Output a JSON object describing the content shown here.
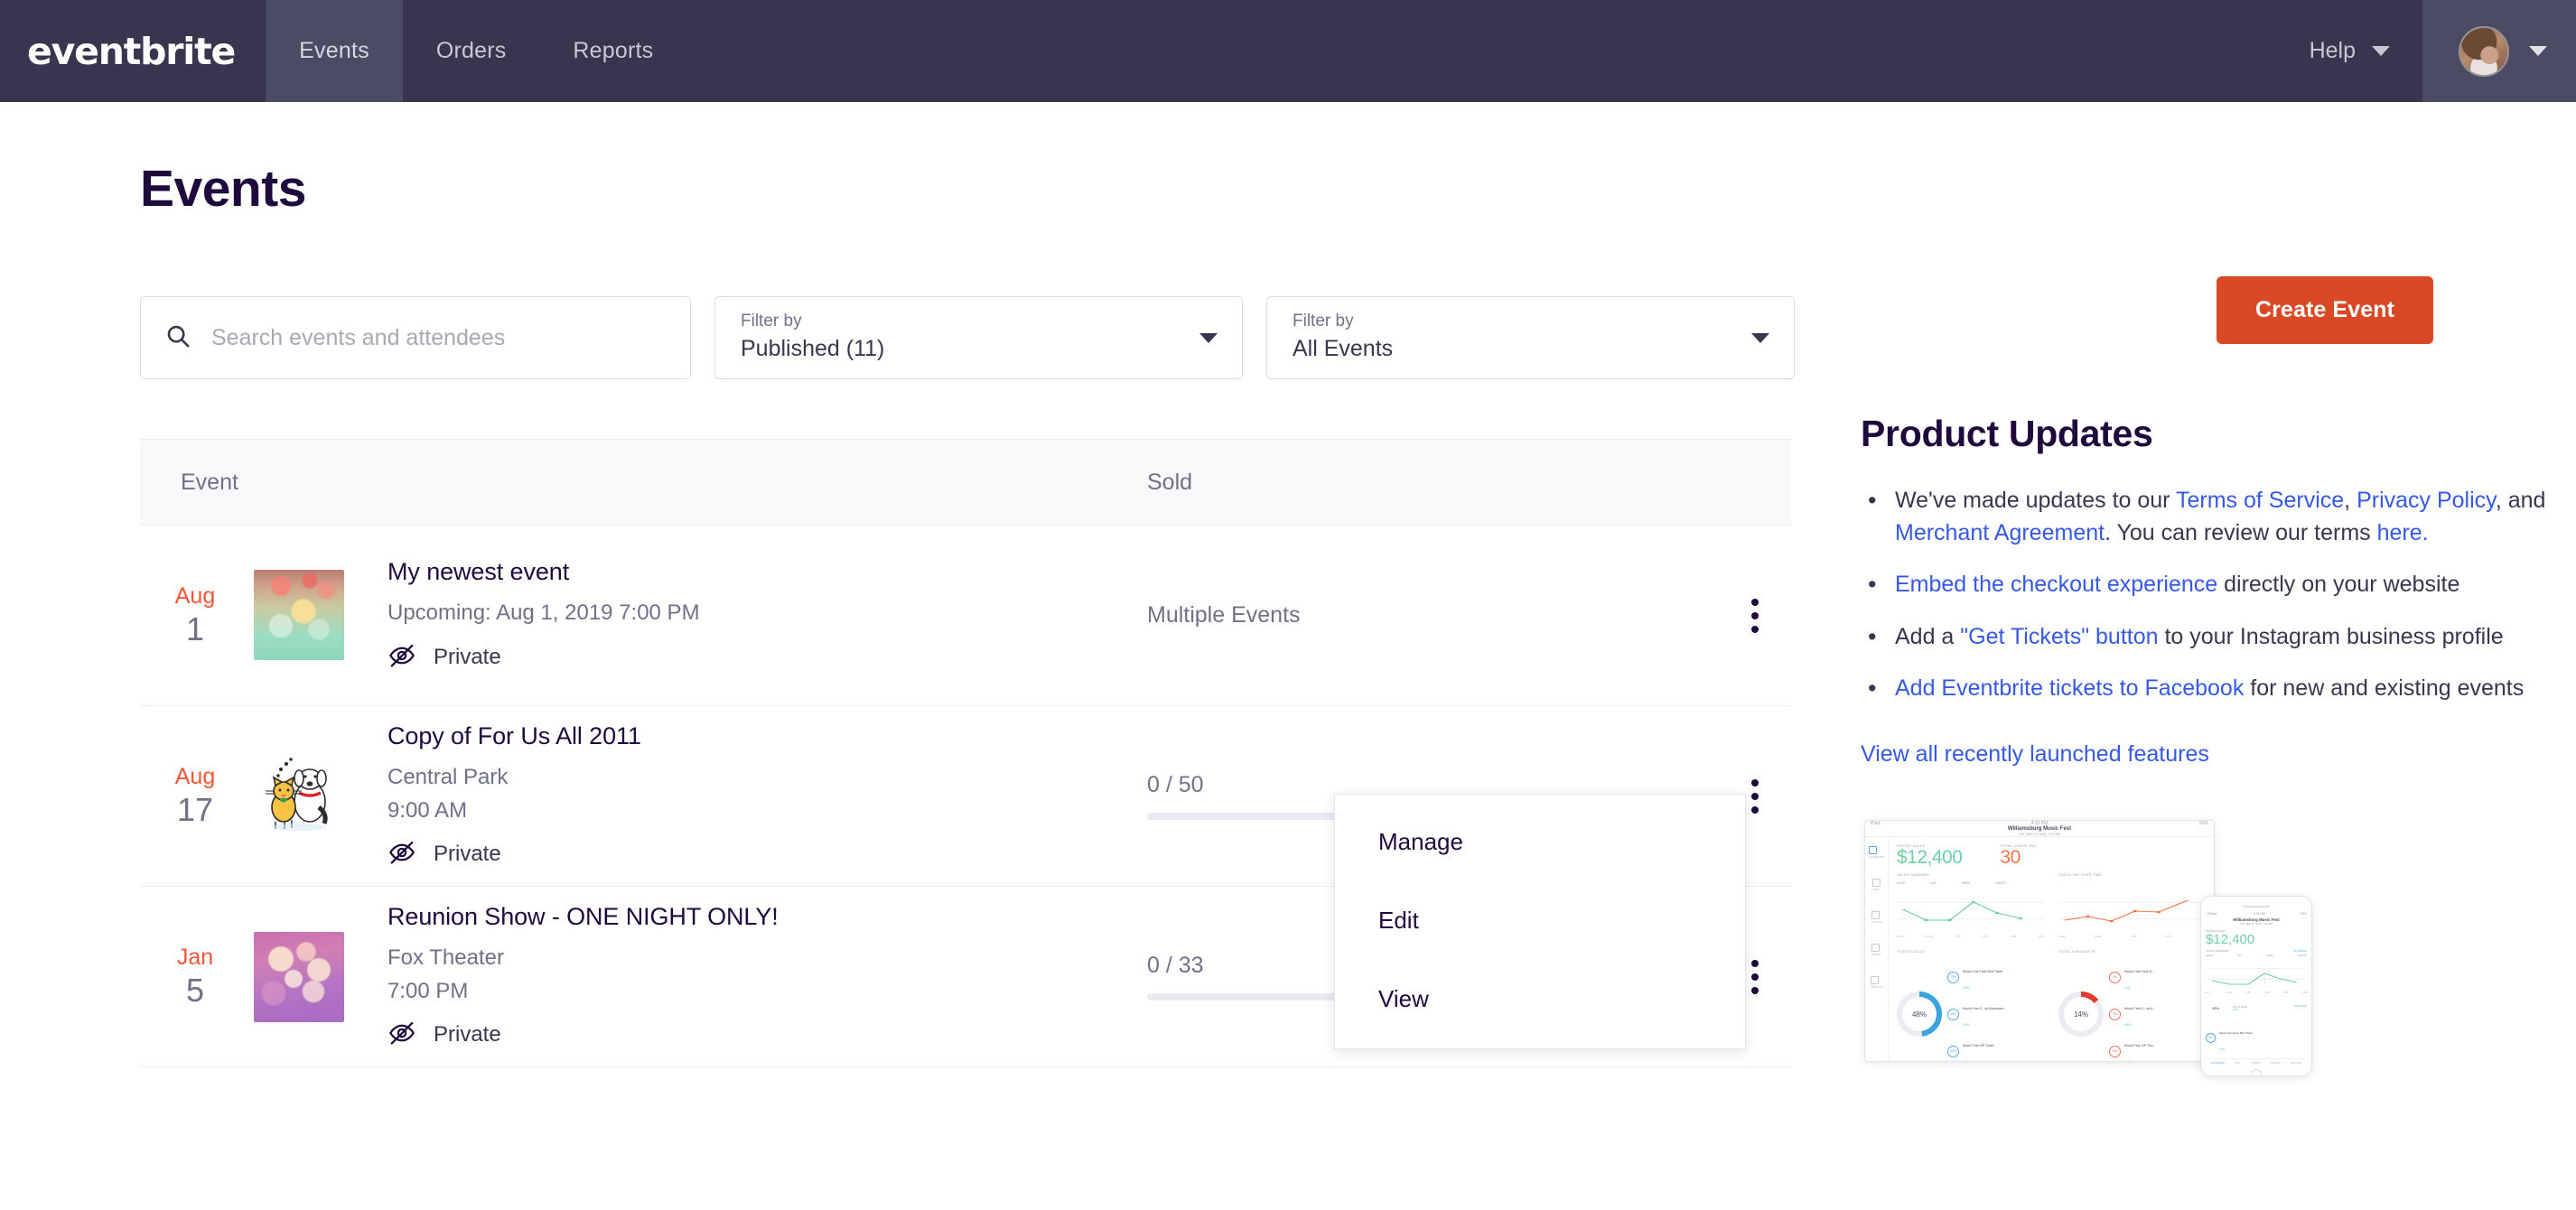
{
  "nav": {
    "brand": "eventbrite",
    "tabs": [
      {
        "label": "Events",
        "active": true
      },
      {
        "label": "Orders",
        "active": false
      },
      {
        "label": "Reports",
        "active": false
      }
    ],
    "help_label": "Help",
    "chevron_icon": "chevron-down-icon",
    "avatar_icon": "user-avatar"
  },
  "header": {
    "title": "Events",
    "create_button": "Create Event",
    "accent_color": "#D94925"
  },
  "filters": {
    "search_placeholder": "Search events and attendees",
    "search_value": "",
    "search_icon": "search-icon",
    "status": {
      "label": "Filter by",
      "value": "Published (11)"
    },
    "scope": {
      "label": "Filter by",
      "value": "All Events"
    }
  },
  "table": {
    "columns": {
      "event": "Event",
      "sold": "Sold"
    },
    "rows": [
      {
        "month": "Aug",
        "day": "1",
        "title": "My newest event",
        "meta_label": "Upcoming:",
        "meta_value": "Aug 1, 2019 7:00 PM",
        "privacy": "Private",
        "privacy_icon": "eye-slash-icon",
        "sold": "Multiple Events",
        "sold_sold": null,
        "sold_capacity": null,
        "progress_pct": 0,
        "has_bar": false,
        "thumb": "bokeh-teal"
      },
      {
        "month": "Aug",
        "day": "17",
        "title": "Copy of For Us All 2011",
        "meta_label": "Central Park",
        "meta_value": "9:00 AM",
        "privacy": "Private",
        "privacy_icon": "eye-slash-icon",
        "sold": "0 / 50",
        "sold_sold": 0,
        "sold_capacity": 50,
        "progress_pct": 0,
        "has_bar": true,
        "thumb": "cats"
      },
      {
        "month": "Jan",
        "day": "5",
        "title": "Reunion Show - ONE NIGHT ONLY!",
        "meta_label": "Fox Theater",
        "meta_value": "7:00 PM",
        "privacy": "Private",
        "privacy_icon": "eye-slash-icon",
        "sold": "0 / 33",
        "sold_sold": 0,
        "sold_capacity": 33,
        "progress_pct": 0,
        "has_bar": true,
        "thumb": "bokeh-pink"
      }
    ]
  },
  "context_menu": {
    "open": true,
    "items": [
      "Manage",
      "Edit",
      "View"
    ]
  },
  "sidebar": {
    "title": "Product Updates",
    "link_color": "#3659E3",
    "bullets": [
      {
        "parts": [
          {
            "t": "We've made updates to our ",
            "link": false
          },
          {
            "t": "Terms of Service",
            "link": true
          },
          {
            "t": ", ",
            "link": false
          },
          {
            "t": "Privacy Policy",
            "link": true
          },
          {
            "t": ", and ",
            "link": false
          },
          {
            "t": "Merchant Agreement",
            "link": true
          },
          {
            "t": ". You can review our terms ",
            "link": false
          },
          {
            "t": "here.",
            "link": true
          }
        ]
      },
      {
        "parts": [
          {
            "t": "Embed the checkout experience",
            "link": true
          },
          {
            "t": " directly on your website",
            "link": false
          }
        ]
      },
      {
        "parts": [
          {
            "t": "Add a ",
            "link": false
          },
          {
            "t": "\"Get Tickets\" button",
            "link": true
          },
          {
            "t": " to your Instagram business profile",
            "link": false
          }
        ]
      },
      {
        "parts": [
          {
            "t": "Add Eventbrite tickets to Facebook",
            "link": true
          },
          {
            "t": " for new and existing events",
            "link": false
          }
        ]
      }
    ],
    "view_all": "View all recently launched features"
  },
  "mockup": {
    "device_status_left": "iPad",
    "device_status_time": "4:31 PM",
    "device_status_battery": "91%",
    "event_title": "Williamsburg Music Fest",
    "event_date": "SAT, SEP 17, 2016, 7:00 PM",
    "rail": [
      {
        "label": "DASHBOARD",
        "active": true
      },
      {
        "label": "SELL",
        "active": false
      },
      {
        "label": "CHECKIN",
        "active": false
      },
      {
        "label": "ORDERS",
        "active": false
      },
      {
        "label": "SETTINGS",
        "active": false
      }
    ],
    "kpi_gross_label": "GROSS SALES",
    "kpi_gross_value": "$12,400",
    "kpi_checkins_label": "TOTAL CHECK INS",
    "kpi_checkins_value": "30",
    "sales_summary_label": "SALES SUMMARY",
    "sales_summary_link": "ON DEVICE",
    "checkins_label": "CHECK INS OVER TIME",
    "range_tabs": [
      "HOUR",
      "DAY",
      "WEEK",
      "MONTH"
    ],
    "y_labels": [
      "$10,000",
      "$5,000"
    ],
    "x_labels": [
      "11 AM",
      "12 PM",
      "1 PM",
      "2 PM",
      "3 PM",
      "4 PM"
    ],
    "tickets_sold_label": "TICKETS SOLD",
    "tickets_sold_link": "SEE MORE",
    "checked_in_label": "TOTAL CHECKED IN",
    "donut_sold_pct": "48%",
    "donut_sold_sub": "235/460",
    "donut_checked_pct": "14%",
    "donut_checked_sub": "32/229",
    "legend_sold": [
      {
        "pct": "70%",
        "name": "Music Fest Early Bird Ticket",
        "sub": "35/50"
      },
      {
        "pct": "68%",
        "name": "Music Fest G...ral Admission",
        "sub": "34/50"
      },
      {
        "pct": "80%",
        "name": "Music Fest VIP Ticket",
        "sub": "40/50"
      }
    ],
    "legend_checked": [
      {
        "pct": "3%",
        "name": "Music Fest Early B...",
        "sub": "1/35"
      },
      {
        "pct": "73%",
        "name": "Music Fest G...ral A...",
        "sub": "26/34"
      },
      {
        "pct": "12%",
        "name": "Music Fest VIP Tick...",
        "sub": "5/40"
      }
    ]
  }
}
